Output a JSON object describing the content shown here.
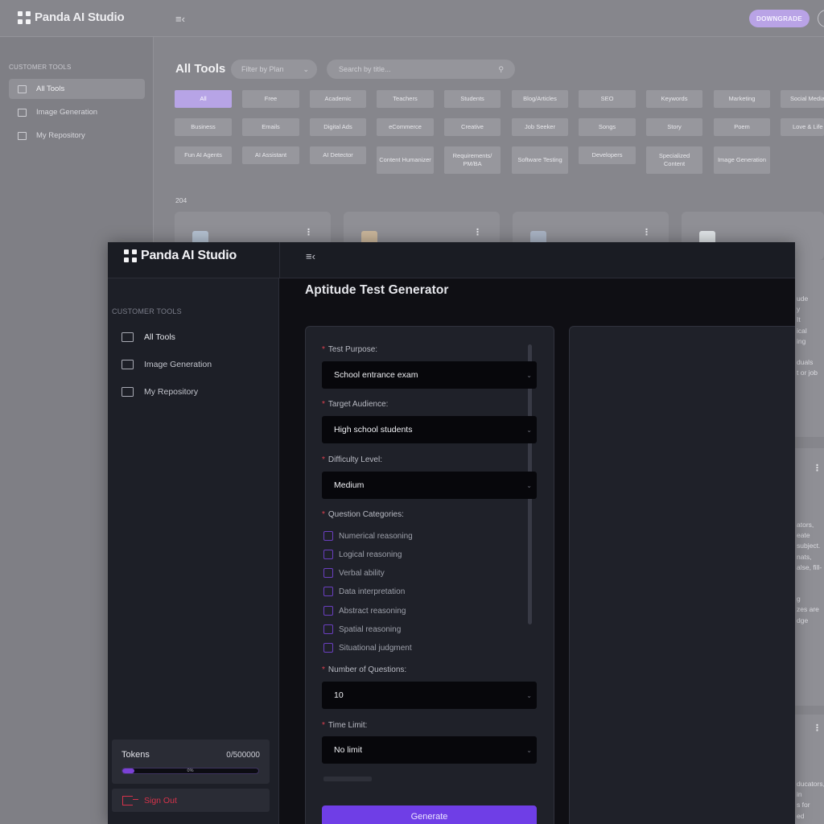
{
  "bg": {
    "brand": "Panda AI Studio",
    "downgrade_label": "DOWNGRADE",
    "sidebar_section": "CUSTOMER TOOLS",
    "nav": [
      {
        "label": "All Tools",
        "icon": "grid-icon"
      },
      {
        "label": "Image Generation",
        "icon": "image-icon"
      },
      {
        "label": "My Repository",
        "icon": "folders-icon"
      }
    ],
    "title": "All Tools",
    "filter_placeholder": "Filter by Plan",
    "search_placeholder": "Search by title...",
    "chips_row1": [
      "All",
      "Free",
      "Academic",
      "Teachers",
      "Students",
      "Blog/Articles",
      "SEO",
      "Keywords",
      "Marketing",
      "Social Media"
    ],
    "chips_row2": [
      "Business",
      "Emails",
      "Digital Ads",
      "eCommerce",
      "Creative",
      "Job Seeker",
      "Songs",
      "Story",
      "Poem",
      "Love & Life"
    ],
    "chips_row3": [
      "Fun AI Agents",
      "AI Assistant",
      "AI Detector",
      "Content Humanizer",
      "Requirements/ PM/BA",
      "Software Testing",
      "Developers",
      "Specialized Content",
      "Image Generation"
    ],
    "tool_count": "204",
    "right_text_1": [
      "ude",
      "y",
      "It",
      "ical",
      "",
      "ing",
      "",
      "duals",
      "t or job"
    ],
    "right_text_2": [
      "ators,",
      "eate",
      "subject.",
      "nats,",
      "alse, fill-",
      "",
      "",
      "g",
      "zes are",
      "dge"
    ],
    "right_text_3": [
      "ducators,",
      "in",
      "s for",
      "ed"
    ]
  },
  "fg": {
    "brand": "Panda AI Studio",
    "sidebar_section": "CUSTOMER TOOLS",
    "nav": [
      {
        "label": "All Tools",
        "icon": "grid-icon"
      },
      {
        "label": "Image Generation",
        "icon": "image-icon"
      },
      {
        "label": "My Repository",
        "icon": "folders-icon"
      }
    ],
    "tokens_label": "Tokens",
    "tokens_count": "0/500000",
    "tokens_percent": "0%",
    "tokens_fraction": 0.09,
    "signout_label": "Sign Out",
    "page_title": "Aptitude Test Generator",
    "form": {
      "test_purpose_label": "Test Purpose:",
      "test_purpose_value": "School entrance exam",
      "target_audience_label": "Target Audience:",
      "target_audience_value": "High school students",
      "difficulty_label": "Difficulty Level:",
      "difficulty_value": "Medium",
      "categories_label": "Question Categories:",
      "categories": [
        "Numerical reasoning",
        "Logical reasoning",
        "Verbal ability",
        "Data interpretation",
        "Abstract reasoning",
        "Spatial reasoning",
        "Situational judgment"
      ],
      "num_questions_label": "Number of Questions:",
      "num_questions_value": "10",
      "time_limit_label": "Time Limit:",
      "time_limit_value": "No limit",
      "generate_label": "Generate"
    }
  },
  "colors": {
    "accent": "#6f3ee6",
    "required": "#e04050",
    "signout": "#d6334b"
  }
}
